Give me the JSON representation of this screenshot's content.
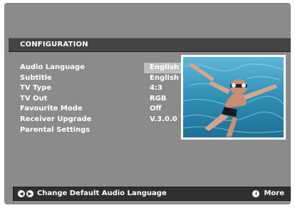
{
  "header": {
    "title": "CONFIGURATION"
  },
  "menu": {
    "items": [
      {
        "label": "Audio Language",
        "value": "English"
      },
      {
        "label": "Subtitle",
        "value": "English"
      },
      {
        "label": "TV Type",
        "value": "4:3"
      },
      {
        "label": "TV Out",
        "value": "RGB"
      },
      {
        "label": "Favourite Mode",
        "value": "Off"
      },
      {
        "label": "Receiver Upgrade",
        "value": "V.3.0.0"
      },
      {
        "label": "Parental Settings",
        "value": ""
      }
    ],
    "selected_index": 0
  },
  "status": {
    "left_icons": [
      "arrow-left-icon",
      "arrow-right-icon"
    ],
    "hint": "Change Default Audio Language",
    "right_icon": "info-icon",
    "right_label": "More"
  },
  "colors": {
    "screen_bg": "#8b8b8b",
    "header_bg": "#444444",
    "status_bg": "#303030",
    "highlight": "#bdbdbd",
    "preview_water": "#2f8fb6"
  }
}
